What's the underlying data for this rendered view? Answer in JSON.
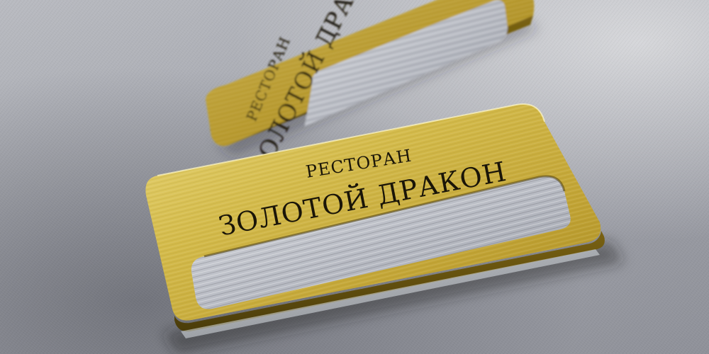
{
  "scene": {
    "subject": "gold brushed-metal name badges with clear name window",
    "surface": "grey textured table"
  },
  "badge_front": {
    "line1": "РЕСТОРАН",
    "line2": "ЗОЛОТОЙ ДРАКОН"
  },
  "badge_back": {
    "line1": "РЕСТОРАН",
    "line2": "ЗОЛОТОЙ ДРАКОН"
  },
  "colors": {
    "gold_light": "#e3cf6a",
    "gold_mid": "#c9ad3a",
    "gold_dark": "#8e7418",
    "engraving": "#1a1508",
    "surface": "#a9abb2"
  }
}
